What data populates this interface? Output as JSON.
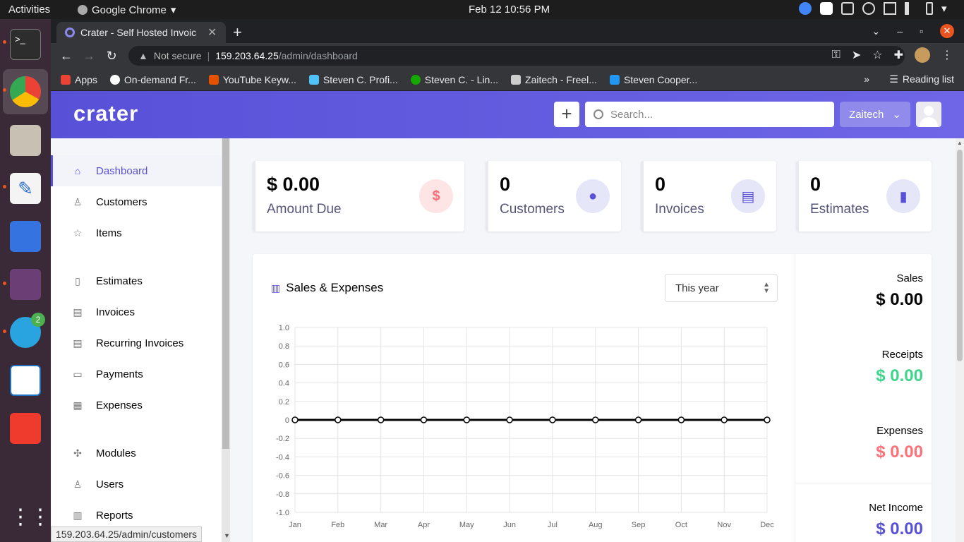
{
  "os": {
    "activities": "Activities",
    "app_name": "Google Chrome",
    "clock": "Feb 12  10:56 PM"
  },
  "dock": {
    "telegram_badge": "2"
  },
  "browser": {
    "tab_title": "Crater - Self Hosted Invoic",
    "url_warning": "Not secure",
    "url_host": "159.203.64.25",
    "url_path": "/admin/dashboard",
    "bookmarks": [
      {
        "label": "Apps",
        "color": "#ea4335"
      },
      {
        "label": "On-demand Fr...",
        "color": "#ffffff"
      },
      {
        "label": "YouTube Keyw...",
        "color": "#e65100"
      },
      {
        "label": "Steven C. Profi...",
        "color": "#4fc3f7"
      },
      {
        "label": "Steven C. - Lin...",
        "color": "#14a800"
      },
      {
        "label": "Zaitech - Freel...",
        "color": "#cccccc"
      },
      {
        "label": "Steven Cooper...",
        "color": "#2196f3"
      }
    ],
    "more": "»",
    "reading_list": "Reading list",
    "status_url": "159.203.64.25/admin/customers"
  },
  "header": {
    "logo": "crater",
    "search_placeholder": "Search...",
    "company": "Zaitech"
  },
  "sidebar": {
    "items": [
      {
        "label": "Dashboard",
        "icon": "home-icon"
      },
      {
        "label": "Customers",
        "icon": "user-icon"
      },
      {
        "label": "Items",
        "icon": "star-icon"
      },
      {
        "label": "Estimates",
        "icon": "document-icon"
      },
      {
        "label": "Invoices",
        "icon": "document-text-icon"
      },
      {
        "label": "Recurring Invoices",
        "icon": "document-text-icon"
      },
      {
        "label": "Payments",
        "icon": "credit-card-icon"
      },
      {
        "label": "Expenses",
        "icon": "calculator-icon"
      },
      {
        "label": "Modules",
        "icon": "puzzle-icon"
      },
      {
        "label": "Users",
        "icon": "users-icon"
      },
      {
        "label": "Reports",
        "icon": "chart-bar-icon"
      }
    ]
  },
  "cards": [
    {
      "value": "$ 0.00",
      "label": "Amount Due",
      "icon": "dollar-icon",
      "icon_color": "#fb7178",
      "icon_bg": "#fde4e5"
    },
    {
      "value": "0",
      "label": "Customers",
      "icon": "user-icon",
      "icon_color": "#5851d8",
      "icon_bg": "#e5e6f8"
    },
    {
      "value": "0",
      "label": "Invoices",
      "icon": "document-icon",
      "icon_color": "#5851d8",
      "icon_bg": "#e5e6f8"
    },
    {
      "value": "0",
      "label": "Estimates",
      "icon": "document-icon",
      "icon_color": "#5851d8",
      "icon_bg": "#e5e6f8"
    }
  ],
  "chart_section": {
    "title": "Sales & Expenses",
    "range": "This year"
  },
  "stats": [
    {
      "label": "Sales",
      "value": "$ 0.00",
      "color": "#040405"
    },
    {
      "label": "Receipts",
      "value": "$ 0.00",
      "color": "#00c99c"
    },
    {
      "label": "Expenses",
      "value": "$ 0.00",
      "color": "#fb7178"
    },
    {
      "label": "Net Income",
      "value": "$ 0.00",
      "color": "#5851d8"
    }
  ],
  "chart_data": {
    "type": "line",
    "categories": [
      "Jan",
      "Feb",
      "Mar",
      "Apr",
      "May",
      "Jun",
      "Jul",
      "Aug",
      "Sep",
      "Oct",
      "Nov",
      "Dec"
    ],
    "series": [
      {
        "values": [
          0,
          0,
          0,
          0,
          0,
          0,
          0,
          0,
          0,
          0,
          0,
          0
        ]
      }
    ],
    "ylim": [
      -1.0,
      1.0
    ],
    "yticks": [
      "1.0",
      "0.8",
      "0.6",
      "0.4",
      "0.2",
      "0",
      "-0.2",
      "-0.4",
      "-0.6",
      "-0.8",
      "-1.0"
    ],
    "grid": true,
    "title": "",
    "xlabel": "",
    "ylabel": ""
  }
}
